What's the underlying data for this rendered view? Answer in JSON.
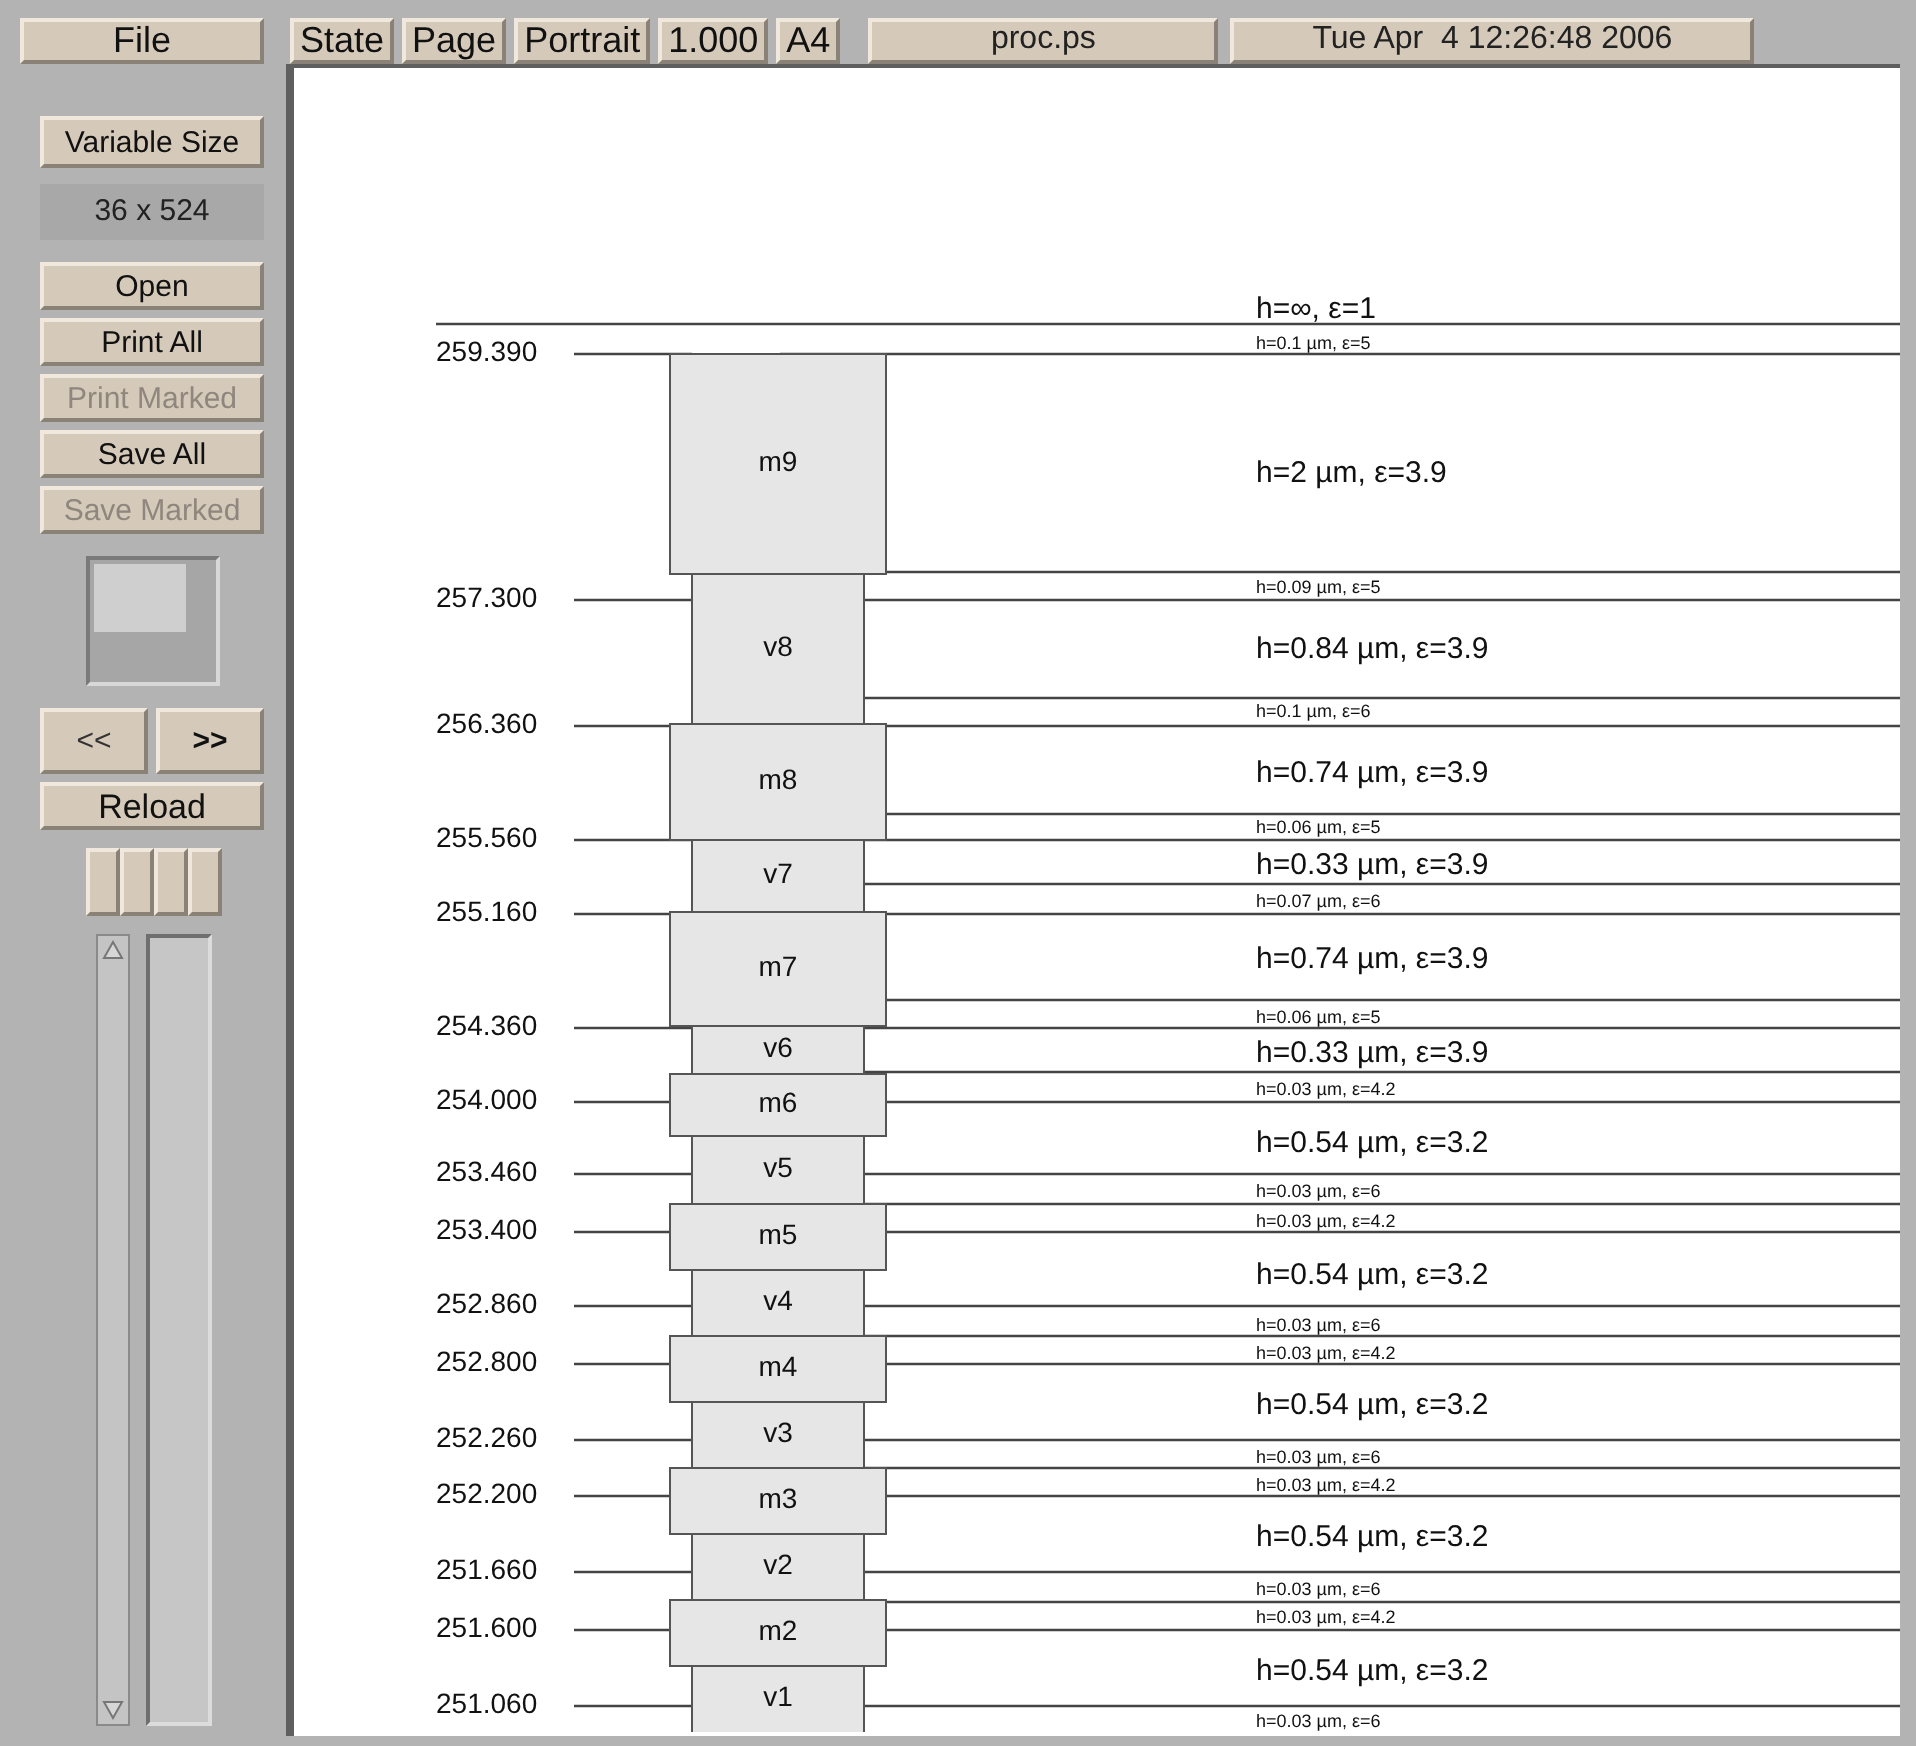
{
  "menu": {
    "file": "File"
  },
  "toolbar": [
    {
      "label": "State"
    },
    {
      "label": "Page"
    },
    {
      "label": "Portrait"
    },
    {
      "label": "1.000"
    },
    {
      "label": "A4"
    }
  ],
  "filename": "proc.ps",
  "date": "Tue Apr  4 12:26:48 2006",
  "sidebar": {
    "size_mode": "Variable Size",
    "dimensions": "36 x 524",
    "buttons": [
      {
        "label": "Open",
        "disabled": false
      },
      {
        "label": "Print All",
        "disabled": false
      },
      {
        "label": "Print Marked",
        "disabled": true
      },
      {
        "label": "Save All",
        "disabled": false
      },
      {
        "label": "Save Marked",
        "disabled": true
      }
    ],
    "prev": "<<",
    "next": ">>",
    "reload": "Reload"
  },
  "diagram": {
    "elevations": [
      "259.390",
      "257.300",
      "256.360",
      "255.560",
      "255.160",
      "254.360",
      "254.000",
      "253.460",
      "253.400",
      "252.860",
      "252.800",
      "252.260",
      "252.200",
      "251.660",
      "251.600",
      "251.060"
    ],
    "blocks": [
      {
        "name": "m9",
        "kind": "metal"
      },
      {
        "name": "v8",
        "kind": "via"
      },
      {
        "name": "m8",
        "kind": "metal"
      },
      {
        "name": "v7",
        "kind": "via"
      },
      {
        "name": "m7",
        "kind": "metal"
      },
      {
        "name": "v6",
        "kind": "via"
      },
      {
        "name": "m6",
        "kind": "metal"
      },
      {
        "name": "v5",
        "kind": "via"
      },
      {
        "name": "m5",
        "kind": "metal"
      },
      {
        "name": "v4",
        "kind": "via"
      },
      {
        "name": "m4",
        "kind": "metal"
      },
      {
        "name": "v3",
        "kind": "via"
      },
      {
        "name": "m3",
        "kind": "metal"
      },
      {
        "name": "v2",
        "kind": "via"
      },
      {
        "name": "m2",
        "kind": "metal"
      },
      {
        "name": "v1",
        "kind": "via"
      }
    ],
    "layer_labels": [
      {
        "text": "h=∞, ε=1",
        "kind": "thick"
      },
      {
        "text": "h=0.1 µm, ε=5",
        "kind": "thin"
      },
      {
        "text": "h=2 µm, ε=3.9",
        "kind": "thick"
      },
      {
        "text": "h=0.09 µm, ε=5",
        "kind": "thin"
      },
      {
        "text": "h=0.84 µm, ε=3.9",
        "kind": "thick"
      },
      {
        "text": "h=0.1 µm, ε=6",
        "kind": "thin"
      },
      {
        "text": "h=0.74 µm, ε=3.9",
        "kind": "thick"
      },
      {
        "text": "h=0.06 µm, ε=5",
        "kind": "thin"
      },
      {
        "text": "h=0.33 µm, ε=3.9",
        "kind": "thick"
      },
      {
        "text": "h=0.07 µm, ε=6",
        "kind": "thin"
      },
      {
        "text": "h=0.74 µm, ε=3.9",
        "kind": "thick"
      },
      {
        "text": "h=0.06 µm, ε=5",
        "kind": "thin"
      },
      {
        "text": "h=0.33 µm, ε=3.9",
        "kind": "thick"
      },
      {
        "text": "h=0.03 µm, ε=4.2",
        "kind": "thin"
      },
      {
        "text": "h=0.54 µm, ε=3.2",
        "kind": "thick"
      },
      {
        "text": "h=0.03 µm, ε=6",
        "kind": "thin"
      },
      {
        "text": "h=0.03 µm, ε=4.2",
        "kind": "thin"
      },
      {
        "text": "h=0.54 µm, ε=3.2",
        "kind": "thick"
      },
      {
        "text": "h=0.03 µm, ε=6",
        "kind": "thin"
      },
      {
        "text": "h=0.03 µm, ε=4.2",
        "kind": "thin"
      },
      {
        "text": "h=0.54 µm, ε=3.2",
        "kind": "thick"
      },
      {
        "text": "h=0.03 µm, ε=6",
        "kind": "thin"
      },
      {
        "text": "h=0.03 µm, ε=4.2",
        "kind": "thin"
      },
      {
        "text": "h=0.54 µm, ε=3.2",
        "kind": "thick"
      },
      {
        "text": "h=0.03 µm, ε=6",
        "kind": "thin"
      },
      {
        "text": "h=0.03 µm, ε=4.2",
        "kind": "thin"
      },
      {
        "text": "h=0.54 µm, ε=3.2",
        "kind": "thick"
      },
      {
        "text": "h=0.03 µm, ε=6",
        "kind": "thin"
      }
    ]
  }
}
